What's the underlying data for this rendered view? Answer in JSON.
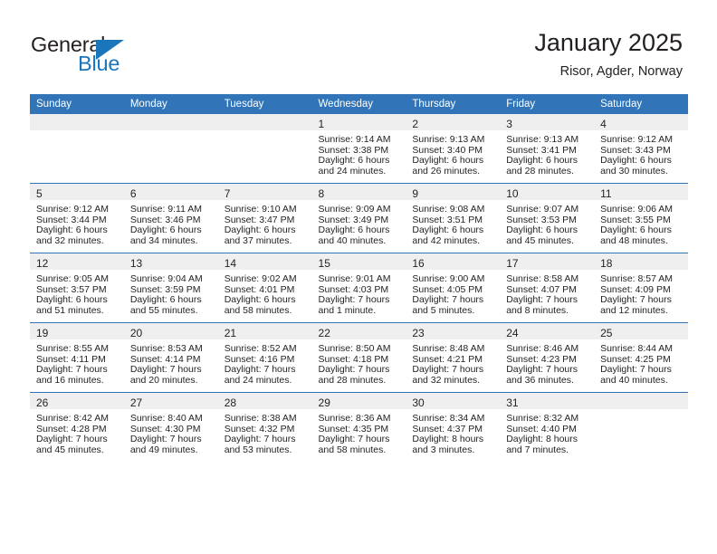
{
  "logo": {
    "word_primary": "General",
    "word_secondary": "Blue",
    "primary_color": "#231f20",
    "secondary_color": "#1b75bb",
    "triangle_icon": "triangle-right-icon"
  },
  "header": {
    "title": "January 2025",
    "location": "Risor, Agder, Norway"
  },
  "theme": {
    "header_blue": "#3175b8",
    "daynum_band": "#efefef",
    "text": "#231f20"
  },
  "weekday_headers": [
    "Sunday",
    "Monday",
    "Tuesday",
    "Wednesday",
    "Thursday",
    "Friday",
    "Saturday"
  ],
  "weeks": [
    [
      {
        "day": "",
        "lines": []
      },
      {
        "day": "",
        "lines": []
      },
      {
        "day": "",
        "lines": []
      },
      {
        "day": "1",
        "lines": [
          "Sunrise: 9:14 AM",
          "Sunset: 3:38 PM",
          "Daylight: 6 hours",
          "and 24 minutes."
        ]
      },
      {
        "day": "2",
        "lines": [
          "Sunrise: 9:13 AM",
          "Sunset: 3:40 PM",
          "Daylight: 6 hours",
          "and 26 minutes."
        ]
      },
      {
        "day": "3",
        "lines": [
          "Sunrise: 9:13 AM",
          "Sunset: 3:41 PM",
          "Daylight: 6 hours",
          "and 28 minutes."
        ]
      },
      {
        "day": "4",
        "lines": [
          "Sunrise: 9:12 AM",
          "Sunset: 3:43 PM",
          "Daylight: 6 hours",
          "and 30 minutes."
        ]
      }
    ],
    [
      {
        "day": "5",
        "lines": [
          "Sunrise: 9:12 AM",
          "Sunset: 3:44 PM",
          "Daylight: 6 hours",
          "and 32 minutes."
        ]
      },
      {
        "day": "6",
        "lines": [
          "Sunrise: 9:11 AM",
          "Sunset: 3:46 PM",
          "Daylight: 6 hours",
          "and 34 minutes."
        ]
      },
      {
        "day": "7",
        "lines": [
          "Sunrise: 9:10 AM",
          "Sunset: 3:47 PM",
          "Daylight: 6 hours",
          "and 37 minutes."
        ]
      },
      {
        "day": "8",
        "lines": [
          "Sunrise: 9:09 AM",
          "Sunset: 3:49 PM",
          "Daylight: 6 hours",
          "and 40 minutes."
        ]
      },
      {
        "day": "9",
        "lines": [
          "Sunrise: 9:08 AM",
          "Sunset: 3:51 PM",
          "Daylight: 6 hours",
          "and 42 minutes."
        ]
      },
      {
        "day": "10",
        "lines": [
          "Sunrise: 9:07 AM",
          "Sunset: 3:53 PM",
          "Daylight: 6 hours",
          "and 45 minutes."
        ]
      },
      {
        "day": "11",
        "lines": [
          "Sunrise: 9:06 AM",
          "Sunset: 3:55 PM",
          "Daylight: 6 hours",
          "and 48 minutes."
        ]
      }
    ],
    [
      {
        "day": "12",
        "lines": [
          "Sunrise: 9:05 AM",
          "Sunset: 3:57 PM",
          "Daylight: 6 hours",
          "and 51 minutes."
        ]
      },
      {
        "day": "13",
        "lines": [
          "Sunrise: 9:04 AM",
          "Sunset: 3:59 PM",
          "Daylight: 6 hours",
          "and 55 minutes."
        ]
      },
      {
        "day": "14",
        "lines": [
          "Sunrise: 9:02 AM",
          "Sunset: 4:01 PM",
          "Daylight: 6 hours",
          "and 58 minutes."
        ]
      },
      {
        "day": "15",
        "lines": [
          "Sunrise: 9:01 AM",
          "Sunset: 4:03 PM",
          "Daylight: 7 hours",
          "and 1 minute."
        ]
      },
      {
        "day": "16",
        "lines": [
          "Sunrise: 9:00 AM",
          "Sunset: 4:05 PM",
          "Daylight: 7 hours",
          "and 5 minutes."
        ]
      },
      {
        "day": "17",
        "lines": [
          "Sunrise: 8:58 AM",
          "Sunset: 4:07 PM",
          "Daylight: 7 hours",
          "and 8 minutes."
        ]
      },
      {
        "day": "18",
        "lines": [
          "Sunrise: 8:57 AM",
          "Sunset: 4:09 PM",
          "Daylight: 7 hours",
          "and 12 minutes."
        ]
      }
    ],
    [
      {
        "day": "19",
        "lines": [
          "Sunrise: 8:55 AM",
          "Sunset: 4:11 PM",
          "Daylight: 7 hours",
          "and 16 minutes."
        ]
      },
      {
        "day": "20",
        "lines": [
          "Sunrise: 8:53 AM",
          "Sunset: 4:14 PM",
          "Daylight: 7 hours",
          "and 20 minutes."
        ]
      },
      {
        "day": "21",
        "lines": [
          "Sunrise: 8:52 AM",
          "Sunset: 4:16 PM",
          "Daylight: 7 hours",
          "and 24 minutes."
        ]
      },
      {
        "day": "22",
        "lines": [
          "Sunrise: 8:50 AM",
          "Sunset: 4:18 PM",
          "Daylight: 7 hours",
          "and 28 minutes."
        ]
      },
      {
        "day": "23",
        "lines": [
          "Sunrise: 8:48 AM",
          "Sunset: 4:21 PM",
          "Daylight: 7 hours",
          "and 32 minutes."
        ]
      },
      {
        "day": "24",
        "lines": [
          "Sunrise: 8:46 AM",
          "Sunset: 4:23 PM",
          "Daylight: 7 hours",
          "and 36 minutes."
        ]
      },
      {
        "day": "25",
        "lines": [
          "Sunrise: 8:44 AM",
          "Sunset: 4:25 PM",
          "Daylight: 7 hours",
          "and 40 minutes."
        ]
      }
    ],
    [
      {
        "day": "26",
        "lines": [
          "Sunrise: 8:42 AM",
          "Sunset: 4:28 PM",
          "Daylight: 7 hours",
          "and 45 minutes."
        ]
      },
      {
        "day": "27",
        "lines": [
          "Sunrise: 8:40 AM",
          "Sunset: 4:30 PM",
          "Daylight: 7 hours",
          "and 49 minutes."
        ]
      },
      {
        "day": "28",
        "lines": [
          "Sunrise: 8:38 AM",
          "Sunset: 4:32 PM",
          "Daylight: 7 hours",
          "and 53 minutes."
        ]
      },
      {
        "day": "29",
        "lines": [
          "Sunrise: 8:36 AM",
          "Sunset: 4:35 PM",
          "Daylight: 7 hours",
          "and 58 minutes."
        ]
      },
      {
        "day": "30",
        "lines": [
          "Sunrise: 8:34 AM",
          "Sunset: 4:37 PM",
          "Daylight: 8 hours",
          "and 3 minutes."
        ]
      },
      {
        "day": "31",
        "lines": [
          "Sunrise: 8:32 AM",
          "Sunset: 4:40 PM",
          "Daylight: 8 hours",
          "and 7 minutes."
        ]
      },
      {
        "day": "",
        "lines": []
      }
    ]
  ]
}
